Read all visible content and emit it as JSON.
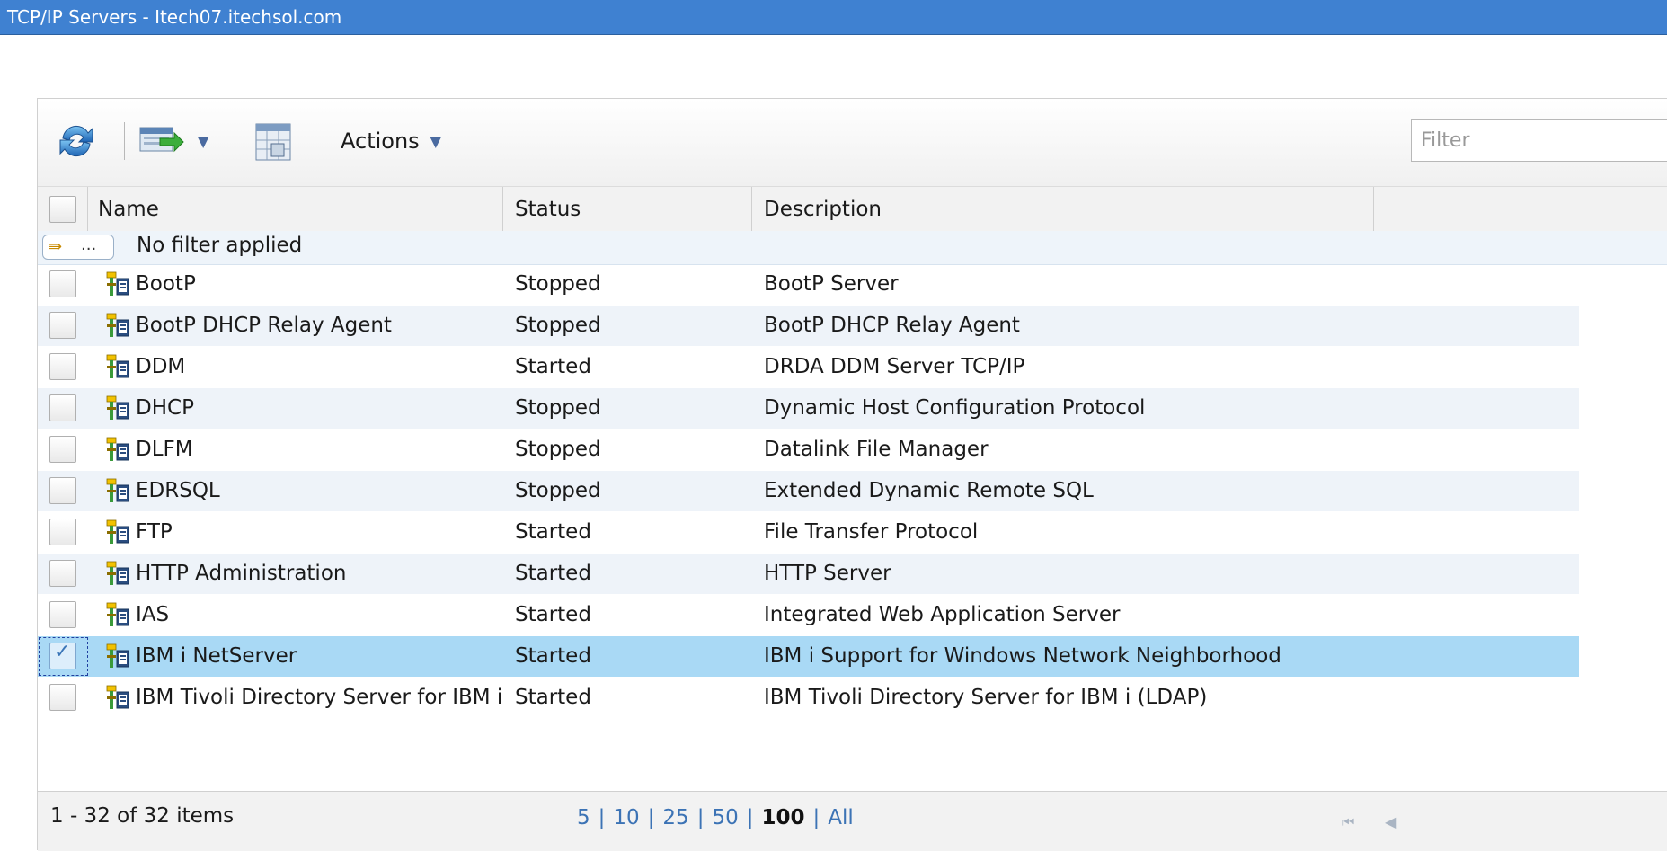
{
  "window": {
    "title": "TCP/IP Servers - Itech07.itechsol.com"
  },
  "toolbar": {
    "actions_label": "Actions",
    "filter_placeholder": "Filter",
    "icons": [
      "refresh-icon",
      "export-icon",
      "columns-icon"
    ]
  },
  "table": {
    "columns": [
      "Name",
      "Status",
      "Description"
    ],
    "filter_status": "No filter applied",
    "filter_button_label": "...",
    "rows": [
      {
        "name": "BootP",
        "status": "Stopped",
        "description": "BootP Server",
        "checked": false
      },
      {
        "name": "BootP DHCP Relay Agent",
        "status": "Stopped",
        "description": "BootP DHCP Relay Agent",
        "checked": false
      },
      {
        "name": "DDM",
        "status": "Started",
        "description": "DRDA DDM Server TCP/IP",
        "checked": false
      },
      {
        "name": "DHCP",
        "status": "Stopped",
        "description": "Dynamic Host Configuration Protocol",
        "checked": false
      },
      {
        "name": "DLFM",
        "status": "Stopped",
        "description": "Datalink File Manager",
        "checked": false
      },
      {
        "name": "EDRSQL",
        "status": "Stopped",
        "description": "Extended Dynamic Remote SQL",
        "checked": false
      },
      {
        "name": "FTP",
        "status": "Started",
        "description": "File Transfer Protocol",
        "checked": false
      },
      {
        "name": "HTTP Administration",
        "status": "Started",
        "description": "HTTP Server",
        "checked": false
      },
      {
        "name": "IAS",
        "status": "Started",
        "description": "Integrated Web Application Server",
        "checked": false
      },
      {
        "name": "IBM i NetServer",
        "status": "Started",
        "description": "IBM i Support for Windows Network Neighborhood",
        "checked": true
      },
      {
        "name": "IBM Tivoli Directory Server for IBM i",
        "status": "Started",
        "description": "IBM Tivoli Directory Server for IBM i (LDAP)",
        "checked": false
      }
    ]
  },
  "footer": {
    "item_count": "1 - 32 of 32 items",
    "page_sizes": [
      "5",
      "10",
      "25",
      "50",
      "100",
      "All"
    ],
    "current_page_size": "100"
  },
  "colors": {
    "title_bar": "#3f81d1",
    "selected_row": "#a9d9f5",
    "alt_row": "#eef3f9",
    "link": "#3c73b5"
  }
}
